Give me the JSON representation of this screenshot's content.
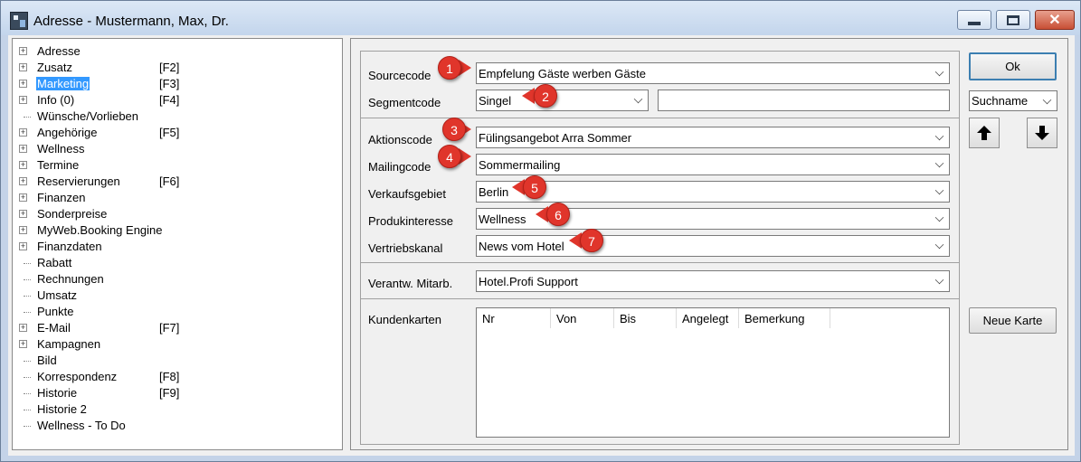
{
  "window": {
    "title": "Adresse - Mustermann, Max, Dr.",
    "close_glyph": "✕"
  },
  "tree": {
    "items": [
      {
        "label": "Adresse",
        "key": "",
        "expandable": true,
        "selected": false
      },
      {
        "label": "Zusatz",
        "key": "[F2]",
        "expandable": true,
        "selected": false
      },
      {
        "label": "Marketing",
        "key": "[F3]",
        "expandable": true,
        "selected": true
      },
      {
        "label": "Info (0)",
        "key": "[F4]",
        "expandable": true,
        "selected": false
      },
      {
        "label": "Wünsche/Vorlieben",
        "key": "",
        "expandable": false,
        "selected": false
      },
      {
        "label": "Angehörige",
        "key": "[F5]",
        "expandable": true,
        "selected": false
      },
      {
        "label": "Wellness",
        "key": "",
        "expandable": true,
        "selected": false
      },
      {
        "label": "Termine",
        "key": "",
        "expandable": true,
        "selected": false
      },
      {
        "label": "Reservierungen",
        "key": "[F6]",
        "expandable": true,
        "selected": false
      },
      {
        "label": "Finanzen",
        "key": "",
        "expandable": true,
        "selected": false
      },
      {
        "label": "Sonderpreise",
        "key": "",
        "expandable": true,
        "selected": false
      },
      {
        "label": "MyWeb.Booking Engine",
        "key": "",
        "expandable": true,
        "selected": false
      },
      {
        "label": "Finanzdaten",
        "key": "",
        "expandable": true,
        "selected": false
      },
      {
        "label": "Rabatt",
        "key": "",
        "expandable": false,
        "selected": false
      },
      {
        "label": "Rechnungen",
        "key": "",
        "expandable": false,
        "selected": false
      },
      {
        "label": "Umsatz",
        "key": "",
        "expandable": false,
        "selected": false
      },
      {
        "label": "Punkte",
        "key": "",
        "expandable": false,
        "selected": false
      },
      {
        "label": "E-Mail",
        "key": "[F7]",
        "expandable": true,
        "selected": false
      },
      {
        "label": "Kampagnen",
        "key": "",
        "expandable": true,
        "selected": false
      },
      {
        "label": "Bild",
        "key": "",
        "expandable": false,
        "selected": false
      },
      {
        "label": "Korrespondenz",
        "key": "[F8]",
        "expandable": false,
        "selected": false
      },
      {
        "label": "Historie",
        "key": "[F9]",
        "expandable": false,
        "selected": false
      },
      {
        "label": "Historie 2",
        "key": "",
        "expandable": false,
        "selected": false
      },
      {
        "label": "Wellness - To Do",
        "key": "",
        "expandable": false,
        "selected": false
      }
    ]
  },
  "form": {
    "sourcecode": {
      "label": "Sourcecode",
      "value": "Empfelung Gäste werben Gäste"
    },
    "segmentcode": {
      "label": "Segmentcode",
      "value": "Singel",
      "extra": ""
    },
    "aktionscode": {
      "label": "Aktionscode",
      "value": "Fülingsangebot Arra Sommer"
    },
    "mailingcode": {
      "label": "Mailingcode",
      "value": "Sommermailing"
    },
    "verkaufsgebiet": {
      "label": "Verkaufsgebiet",
      "value": "Berlin"
    },
    "produkinteresse": {
      "label": "Produkinteresse",
      "value": "Wellness"
    },
    "vertriebskanal": {
      "label": "Vertriebskanal",
      "value": "News vom Hotel"
    },
    "mitarbeiter": {
      "label": "Verantw. Mitarb.",
      "value": "Hotel.Profi Support"
    },
    "kundenkarten": {
      "label": "Kundenkarten",
      "columns": [
        "Nr",
        "Von",
        "Bis",
        "Angelegt",
        "Bemerkung"
      ]
    }
  },
  "side": {
    "ok_label": "Ok",
    "search_select": "Suchname",
    "neue_karte_label": "Neue Karte"
  },
  "badges": [
    "1",
    "2",
    "3",
    "4",
    "5",
    "6",
    "7"
  ],
  "colors": {
    "selection": "#3399ff",
    "badge": "#e0352b",
    "window_frame": "#c4d3e8",
    "close_button": "#c84f35"
  }
}
